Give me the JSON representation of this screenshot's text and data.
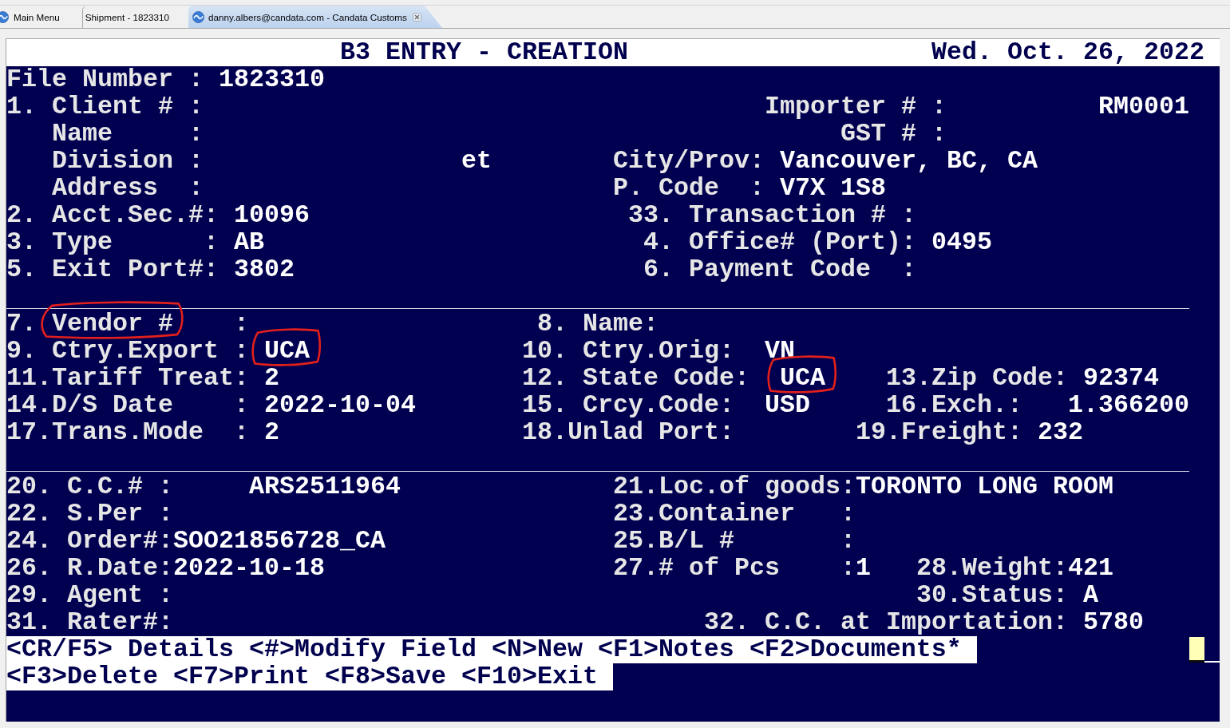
{
  "tabs": [
    {
      "label": "Main Menu",
      "icon": true,
      "selected": false
    },
    {
      "label": "Shipment - 1823310",
      "icon": false,
      "selected": false
    },
    {
      "label": "danny.albers@candata.com - Candata Customs",
      "icon": true,
      "selected": true
    }
  ],
  "screen": {
    "title": "B3 ENTRY - CREATION",
    "date": "Wed. Oct. 26, 2022",
    "header": [
      [
        {
          "text": "File Number :",
          "kind": "label",
          "circled": false
        },
        {
          "text": "1823310",
          "kind": "value",
          "circled": false
        }
      ],
      [
        {
          "text": "1. Client # :",
          "kind": "label",
          "circled": false
        },
        {
          "text": "Importer # :",
          "kind": "label",
          "circled": false
        },
        {
          "text": "RM0001",
          "kind": "value",
          "circled": false
        }
      ],
      [
        {
          "text": "Name     :",
          "kind": "label",
          "circled": false
        },
        {
          "text": "GST # :",
          "kind": "label",
          "circled": false
        }
      ],
      [
        {
          "text": "Division :",
          "kind": "label",
          "circled": false
        },
        {
          "text": "et",
          "kind": "value",
          "circled": false
        },
        {
          "text": "City/Prov:",
          "kind": "label",
          "circled": false
        },
        {
          "text": "Vancouver, BC, CA",
          "kind": "value",
          "circled": false
        }
      ],
      [
        {
          "text": "Address  :",
          "kind": "label",
          "circled": false
        },
        {
          "text": "P. Code  :",
          "kind": "label",
          "circled": false
        },
        {
          "text": "V7X 1S8",
          "kind": "value",
          "circled": false
        }
      ],
      [
        {
          "text": "2. Acct.Sec.#:",
          "kind": "label",
          "circled": false
        },
        {
          "text": "10096",
          "kind": "value",
          "circled": false
        },
        {
          "text": "33. Transaction # :",
          "kind": "label",
          "circled": false
        }
      ],
      [
        {
          "text": "3. Type      :",
          "kind": "label",
          "circled": false
        },
        {
          "text": "AB",
          "kind": "value",
          "circled": false
        },
        {
          "text": "4. Office# (Port):",
          "kind": "label",
          "circled": false
        },
        {
          "text": "0495",
          "kind": "value",
          "circled": false
        }
      ],
      [
        {
          "text": "5. Exit Port#:",
          "kind": "label",
          "circled": false
        },
        {
          "text": "3802",
          "kind": "value",
          "circled": false
        },
        {
          "text": "6. Payment Code  :",
          "kind": "label",
          "circled": false
        }
      ]
    ],
    "vendor": [
      [
        {
          "text": "7.",
          "kind": "label",
          "circled": false
        },
        {
          "text": "Vendor #",
          "kind": "label",
          "circled": true
        },
        {
          "text": ":",
          "kind": "label",
          "circled": false
        },
        {
          "text": "8. Name:",
          "kind": "label",
          "circled": false
        }
      ],
      [
        {
          "text": "9. Ctry.Export :",
          "kind": "label",
          "circled": false
        },
        {
          "text": "UCA",
          "kind": "value",
          "circled": true
        },
        {
          "text": "10. Ctry.Orig:",
          "kind": "label",
          "circled": false
        },
        {
          "text": "VN",
          "kind": "value",
          "circled": false
        }
      ],
      [
        {
          "text": "11.Tariff Treat:",
          "kind": "label",
          "circled": false
        },
        {
          "text": "2",
          "kind": "value",
          "circled": false
        },
        {
          "text": "12. State Code:",
          "kind": "label",
          "circled": false
        },
        {
          "text": "UCA",
          "kind": "value",
          "circled": true
        },
        {
          "text": "13.Zip Code:",
          "kind": "label",
          "circled": false
        },
        {
          "text": "92374",
          "kind": "value",
          "circled": false
        }
      ],
      [
        {
          "text": "14.D/S Date    :",
          "kind": "label",
          "circled": false
        },
        {
          "text": "2022-10-04",
          "kind": "value",
          "circled": false
        },
        {
          "text": "15. Crcy.Code:",
          "kind": "label",
          "circled": false
        },
        {
          "text": "USD",
          "kind": "value",
          "circled": false
        },
        {
          "text": "16.Exch.:",
          "kind": "label",
          "circled": false
        },
        {
          "text": "1.366200",
          "kind": "value",
          "circled": false
        }
      ],
      [
        {
          "text": "17.Trans.Mode  :",
          "kind": "label",
          "circled": false
        },
        {
          "text": "2",
          "kind": "value",
          "circled": false
        },
        {
          "text": "18.Unlad Port:",
          "kind": "label",
          "circled": false
        },
        {
          "text": "19.Freight:",
          "kind": "label",
          "circled": false
        },
        {
          "text": "232",
          "kind": "value",
          "circled": false
        }
      ]
    ],
    "shipment": [
      [
        {
          "text": "20. C.C.# :",
          "kind": "label",
          "circled": false
        },
        {
          "text": "ARS2511964",
          "kind": "value",
          "circled": false
        },
        {
          "text": "21.Loc.of goods:",
          "kind": "label",
          "circled": false
        },
        {
          "text": "TORONTO LONG ROOM",
          "kind": "value",
          "circled": false
        }
      ],
      [
        {
          "text": "22. S.Per :",
          "kind": "label",
          "circled": false
        },
        {
          "text": "23.Container   :",
          "kind": "label",
          "circled": false
        }
      ],
      [
        {
          "text": "24. Order#:",
          "kind": "label",
          "circled": false
        },
        {
          "text": "SOO21856728_CA",
          "kind": "value",
          "circled": false
        },
        {
          "text": "25.B/L #       :",
          "kind": "label",
          "circled": false
        }
      ],
      [
        {
          "text": "26. R.Date:",
          "kind": "label",
          "circled": false
        },
        {
          "text": "2022-10-18",
          "kind": "value",
          "circled": false
        },
        {
          "text": "27.# of Pcs    :",
          "kind": "label",
          "circled": false
        },
        {
          "text": "1",
          "kind": "value",
          "circled": false
        },
        {
          "text": "28.Weight:",
          "kind": "label",
          "circled": false
        },
        {
          "text": "421",
          "kind": "value",
          "circled": false
        }
      ],
      [
        {
          "text": "29. Agent :",
          "kind": "label",
          "circled": false
        },
        {
          "text": "30.Status:",
          "kind": "label",
          "circled": false
        },
        {
          "text": "A",
          "kind": "value",
          "circled": false
        }
      ],
      [
        {
          "text": "31. Rater#:",
          "kind": "label",
          "circled": false
        },
        {
          "text": "32. C.C. at Importation:",
          "kind": "label",
          "circled": false
        },
        {
          "text": "5780",
          "kind": "value",
          "circled": false
        }
      ]
    ],
    "function_keys": [
      [
        "<CR/F5> Details",
        "<#>Modify Field",
        "<N>New",
        "<F1>Notes",
        "<F2>Documents*"
      ],
      [
        "<F3>Delete",
        "<F7>Print",
        "<F8>Save",
        "<F10>Exit"
      ]
    ]
  }
}
